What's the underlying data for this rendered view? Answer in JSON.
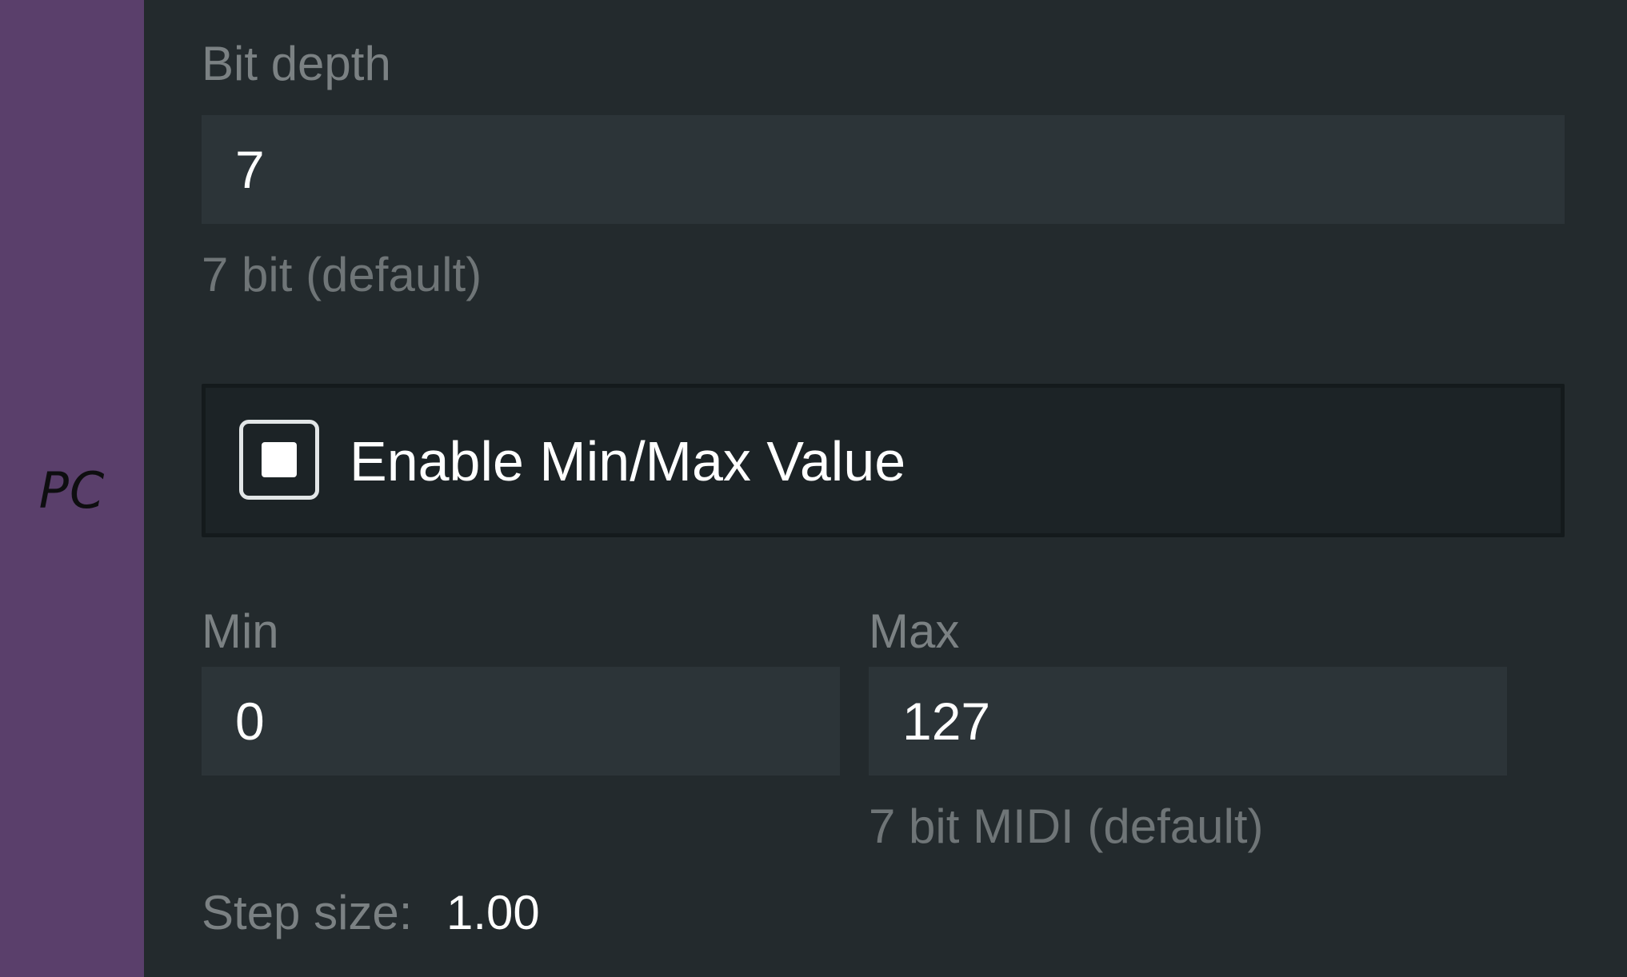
{
  "sidebar": {
    "label": "PC",
    "color": "#5a3f6b"
  },
  "bit_depth": {
    "label": "Bit depth",
    "value": "7",
    "hint": "7 bit (default)"
  },
  "min_max_toggle": {
    "label": "Enable Min/Max Value",
    "checked": true
  },
  "min": {
    "label": "Min",
    "value": "0"
  },
  "max": {
    "label": "Max",
    "value": "127",
    "hint": "7 bit MIDI (default)"
  },
  "step": {
    "label": "Step size:",
    "value": "1.00"
  },
  "colors": {
    "background": "#232a2d",
    "field": "#2c3438",
    "label": "#7b8183",
    "text": "#ffffff"
  }
}
